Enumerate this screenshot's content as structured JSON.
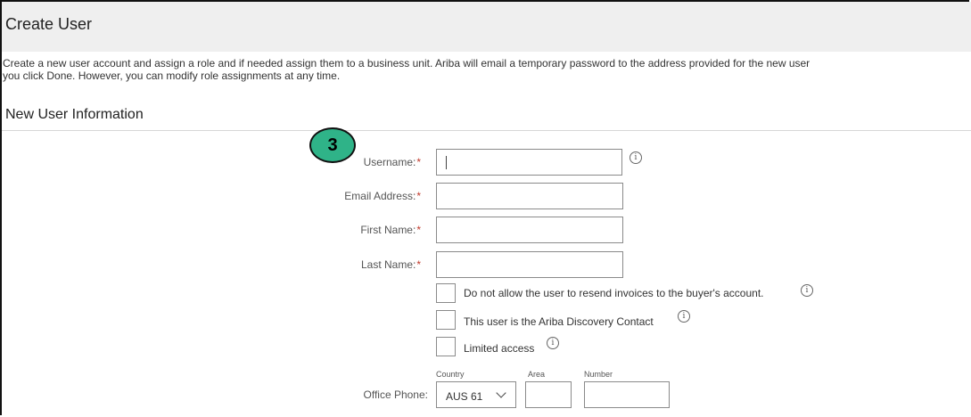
{
  "page": {
    "title": "Create User",
    "description_line1": "Create a new user account and assign a role and if needed assign them to a business unit. Ariba will email a temporary password to the address provided for the new user",
    "description_line2": "you click Done. However, you can modify role assignments at any time.",
    "section_title": "New User Information",
    "step_number": "3"
  },
  "form": {
    "username_label": "Username:",
    "email_label": "Email Address:",
    "first_name_label": "First Name:",
    "last_name_label": "Last Name:",
    "required_mark": "*",
    "username_value": "",
    "email_value": "",
    "first_name_value": "",
    "last_name_value": "",
    "checkbox_resend_label": "Do not allow the user to resend invoices to the buyer's account.",
    "checkbox_discovery_label": "This user is the Ariba Discovery Contact",
    "checkbox_limited_label": "Limited access",
    "checkbox_resend_checked": false,
    "checkbox_discovery_checked": false,
    "checkbox_limited_checked": false,
    "office_phone_label": "Office Phone:",
    "country_header": "Country",
    "area_header": "Area",
    "number_header": "Number",
    "country_value": "AUS 61",
    "area_value": "",
    "number_value": ""
  },
  "icons": {
    "info_glyph": "i"
  },
  "colors": {
    "badge": "#2fb388",
    "required": "#c0392b",
    "header_bg": "#efefef"
  }
}
